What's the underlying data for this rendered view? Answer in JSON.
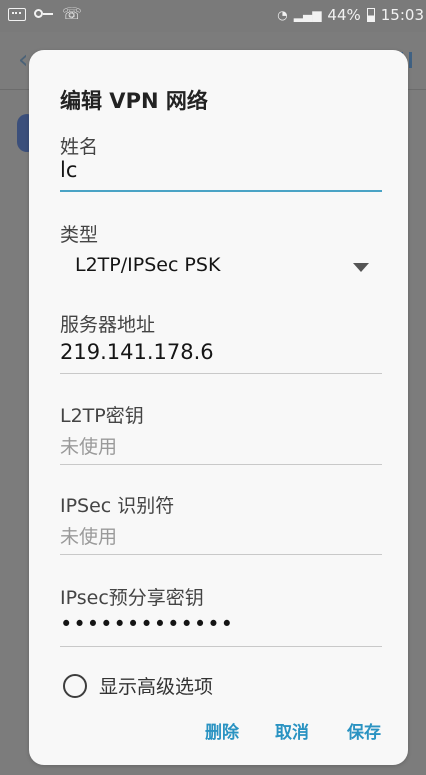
{
  "status_bar": {
    "battery_percent": "44%",
    "time": "15:03",
    "icons": [
      "keyboard-icon",
      "key-icon",
      "wifi-calling-icon",
      "wifi-icon",
      "signal-icon",
      "battery-icon"
    ]
  },
  "dialog": {
    "title": "编辑 VPN 网络",
    "fields": {
      "name": {
        "label": "姓名",
        "value": "lc"
      },
      "type": {
        "label": "类型",
        "value": "L2TP/IPSec PSK"
      },
      "server": {
        "label": "服务器地址",
        "value": "219.141.178.6"
      },
      "l2tp_key": {
        "label": "L2TP密钥",
        "placeholder": "未使用"
      },
      "ipsec_id": {
        "label": "IPSec 识别符",
        "placeholder": "未使用"
      },
      "ipsec_psk": {
        "label": "IPsec预分享密钥",
        "value": "•••••••••••••"
      }
    },
    "advanced_option": "显示高级选项",
    "actions": {
      "delete": "删除",
      "cancel": "取消",
      "save": "保存"
    }
  }
}
